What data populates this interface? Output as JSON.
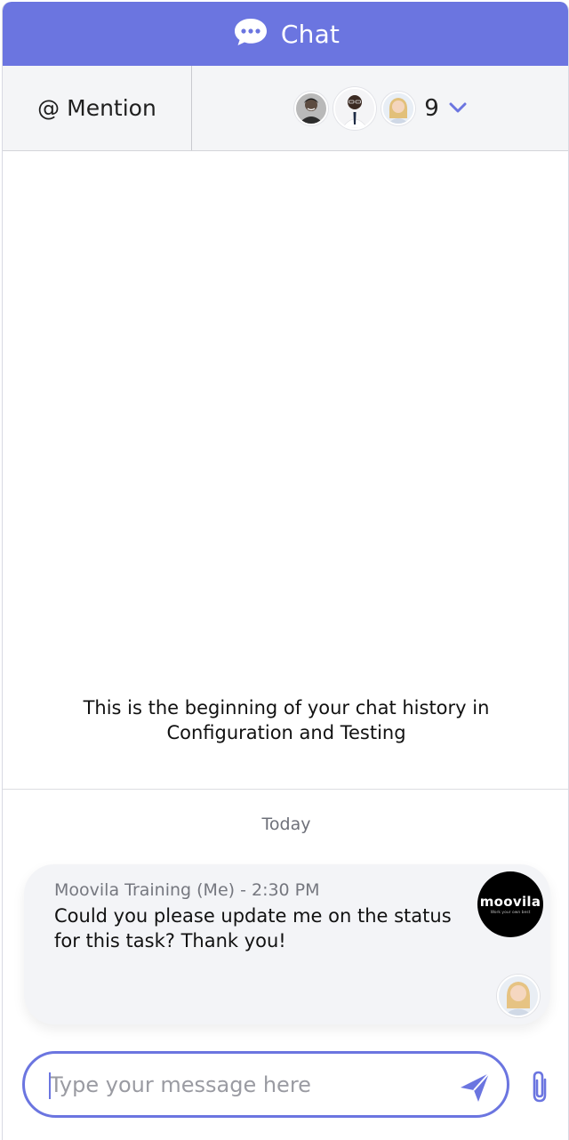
{
  "header": {
    "title": "Chat",
    "icon": "chat-bubble-icon"
  },
  "toolbar": {
    "mention_label": "@ Mention",
    "participants": {
      "avatars": [
        "avatar-man-smiling",
        "avatar-man-glasses-tie",
        "avatar-woman-blonde"
      ],
      "count": "9",
      "icon": "chevron-down-icon"
    }
  },
  "history": {
    "beginning_text_line1": "This is the beginning of your chat history in",
    "beginning_text_line2": "Configuration and Testing"
  },
  "divider_label": "Today",
  "messages": [
    {
      "meta": "Moovila Training (Me) - 2:30 PM",
      "body": "Could you please update me on the status for this task? Thank you!",
      "sender_logo_text": "moovila",
      "sender_logo_tagline": "Work your own best"
    }
  ],
  "composer": {
    "placeholder": "Type your message here",
    "value": "",
    "send_icon": "send-icon",
    "attach_icon": "paperclip-icon"
  },
  "colors": {
    "accent": "#6b75e0",
    "toolbar_bg": "#f4f5f7",
    "bubble_bg": "#f3f4f7"
  }
}
